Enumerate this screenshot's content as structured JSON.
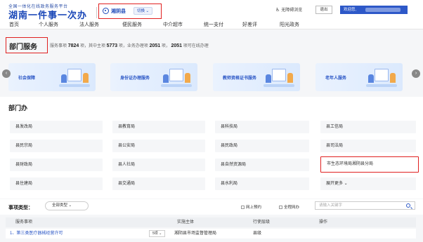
{
  "header": {
    "logo_small": "全国一体化在线政务服务平台",
    "logo_big": "湖南一件事一次办",
    "region": "湘阴县",
    "switch_label": "切换",
    "access_label": "无障碍浏览",
    "logout_label": "退出",
    "welcome_label": "欢迎您,"
  },
  "nav": {
    "items": [
      "首页",
      "个人服务",
      "法人服务",
      "便民服务",
      "中介超市",
      "统一支付",
      "好差评",
      "阳光政务"
    ]
  },
  "section": {
    "title": "部门服务",
    "stats_prefix": "服务事项",
    "stats_total": "7824",
    "stats_mid1": "项，其中主项",
    "stats_main": "5773",
    "stats_mid2": "项，业务办理项",
    "stats_biz": "2051",
    "stats_mid3": "项，",
    "stats_online": "2051",
    "stats_suffix": "项可在线办理"
  },
  "banners": [
    "社会保障",
    "身份证办理服务",
    "教师资格证书服务",
    "老年人服务"
  ],
  "departments": {
    "title": "部门办",
    "rows": [
      [
        "县发改局",
        "县教育局",
        "县科技局",
        "县工信局"
      ],
      [
        "县民宗局",
        "县公安局",
        "县民政局",
        "县司法局"
      ],
      [
        "县财政局",
        "县人社局",
        "县自然资源局",
        "市生态环境局湘阴县分局"
      ],
      [
        "县住建局",
        "县交通局",
        "县水利局",
        "展开更多"
      ]
    ]
  },
  "filter": {
    "label": "事项类型：",
    "select_value": "全部类型",
    "check1": "网上预约",
    "check2": "全程网办",
    "search_placeholder": "请输入关键字"
  },
  "table": {
    "headers": [
      "服务事项",
      "实施主体",
      "行使层级",
      "操作"
    ],
    "rows": [
      {
        "item": "1、第三类医疗器械经营许可",
        "count": "5项",
        "org": "湘阴县市场监督管理局",
        "level": "县级"
      }
    ]
  }
}
